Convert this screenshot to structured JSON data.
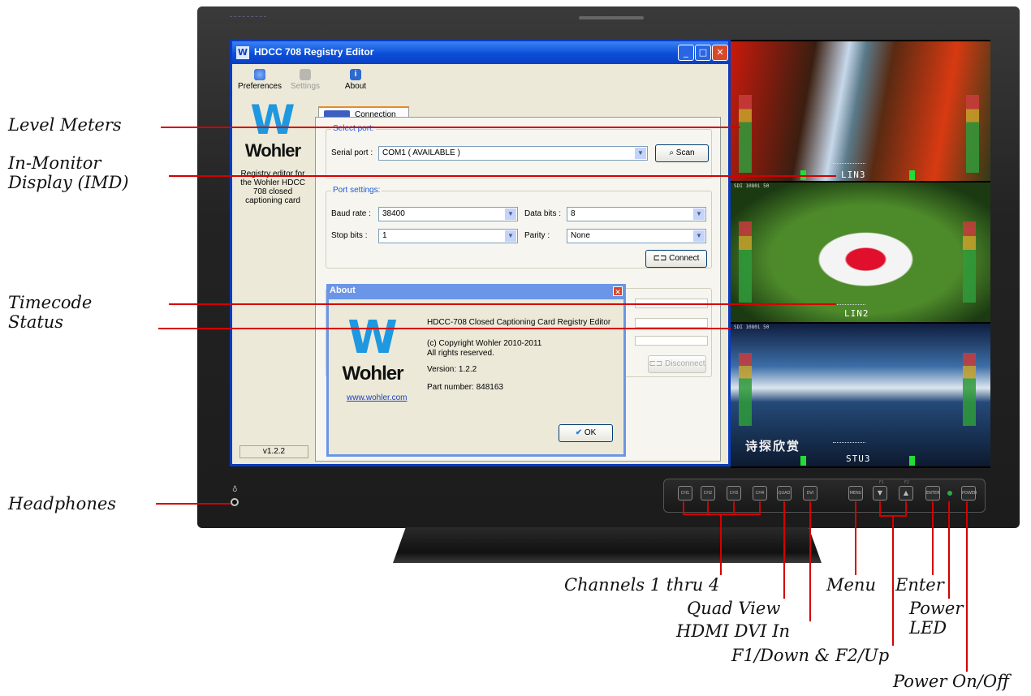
{
  "window": {
    "title": "HDCC 708 Registry Editor",
    "app_icon_glyph": "W",
    "min_glyph": "_",
    "max_glyph": "□",
    "close_glyph": "✕"
  },
  "toolbar": {
    "preferences_label": "Preferences",
    "settings_label": "Settings",
    "about_label": "About",
    "about_icon_glyph": "i"
  },
  "left_pane": {
    "logo_mark": "W",
    "logo_word": "Wohler",
    "description": "Registry editor for the Wohler HDCC 708 closed captioning card",
    "version": "v1.2.2"
  },
  "tab": {
    "label": "Connection"
  },
  "select_port": {
    "group_label": "Select port:",
    "serial_label": "Serial port :",
    "serial_value": "COM1 ( AVAILABLE )",
    "scan_label": "Scan"
  },
  "port_settings": {
    "group_label": "Port settings:",
    "baud_label": "Baud rate :",
    "baud_value": "38400",
    "data_bits_label": "Data bits :",
    "data_bits_value": "8",
    "stop_bits_label": "Stop bits :",
    "stop_bits_value": "1",
    "parity_label": "Parity :",
    "parity_value": "None",
    "connect_label": "Connect",
    "disconnect_label": "Disconnect",
    "dropdown_glyph": "▼"
  },
  "about_dialog": {
    "title": "About",
    "close_glyph": "✕",
    "logo_mark": "W",
    "logo_word": "Wohler",
    "link": "www.wohler.com",
    "product": "HDCC-708 Closed Captioning Card Registry Editor",
    "copyright": "(c) Copyright Wohler 2010-2011",
    "rights": "All rights reserved.",
    "version": "Version: 1.2.2",
    "part_number": "Part number: 848163",
    "ok_label": "OK",
    "ok_glyph": "✔"
  },
  "video": {
    "quad1_label": "LIN3",
    "quad2_label": "LIN2",
    "quad3_label": "STU3",
    "sdi_label_2": "SDI 1080i 50",
    "sdi_label_3": "SDI 1080i 50",
    "quad3_caption": "诗探欣赏"
  },
  "front_panel": {
    "ch1": "CH1",
    "ch2": "CH2",
    "ch3": "CH3",
    "ch4": "CH4",
    "quad": "QUAD",
    "dvi": "DVI",
    "menu": "MENU",
    "down_glyph": "▼",
    "up_glyph": "▲",
    "f1_label": "F1",
    "f2_label": "F2",
    "enter": "ENTER",
    "power": "POWER",
    "headphone_glyph": "♁"
  },
  "callouts": {
    "level_meters": "Level Meters",
    "imd": "In-Monitor Display (IMD)",
    "timecode": "Timecode Status",
    "headphones": "Headphones",
    "channels": "Channels 1 thru 4",
    "quad_view": "Quad View",
    "hdmi_dvi": "HDMI DVI In",
    "f1_f2": "F1/Down & F2/Up",
    "menu": "Menu",
    "enter": "Enter",
    "power_led": "Power LED",
    "power_on_off": "Power On/Off"
  },
  "colors": {
    "callout_line": "#d40000",
    "xp_title_blue": "#0b4ed8",
    "xp_face": "#ece9d8",
    "wohler_blue": "#1e98e0"
  }
}
